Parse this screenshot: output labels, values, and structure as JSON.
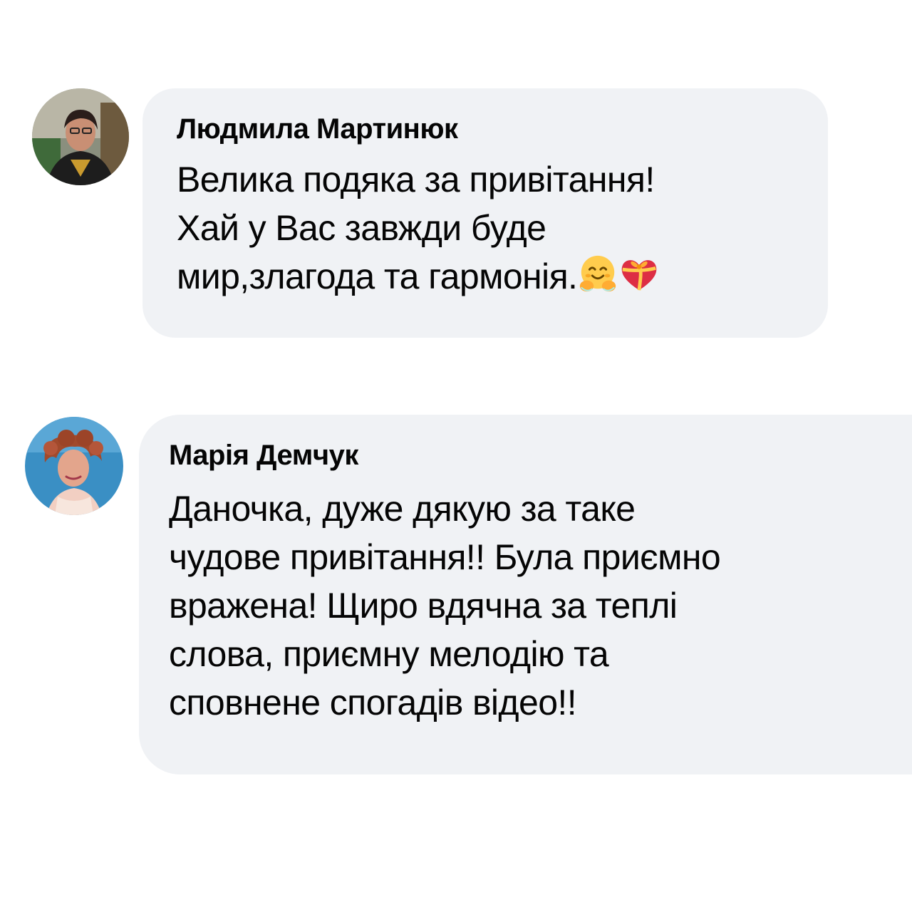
{
  "comments": [
    {
      "author": "Людмила Мартинюк",
      "avatar_icon": "profile-photo-avatar",
      "lines": [
        "Велика подяка за привітання!",
        "Хай у Вас завжди буде",
        "мир,злагода та гармонія."
      ],
      "emojis": [
        "hugging-face-emoji",
        "heart-with-ribbon-emoji"
      ]
    },
    {
      "author": "Марія Демчук",
      "avatar_icon": "profile-photo-avatar",
      "lines": [
        "Даночка, дуже дякую за таке",
        "чудове привітання!! Була приємно",
        "вражена! Щиро вдячна за теплі",
        "слова, приємну мелодію та",
        "сповнене спогадів відео!!"
      ],
      "emojis": []
    }
  ],
  "colors": {
    "bubble_background": "#f0f2f5",
    "text": "#050505"
  }
}
